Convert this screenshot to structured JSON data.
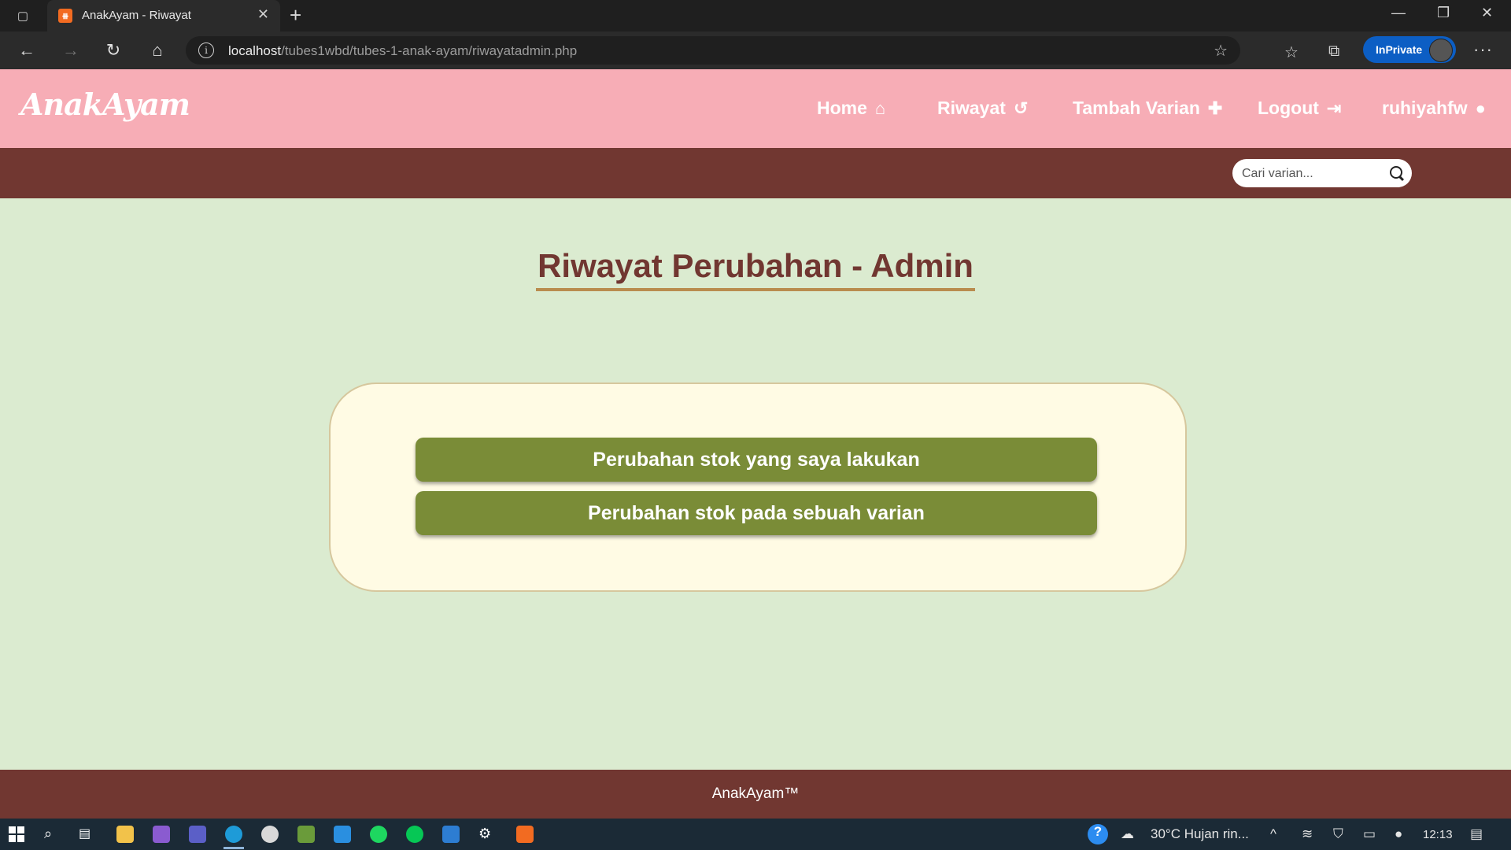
{
  "browser": {
    "tab_title": "AnakAyam - Riwayat",
    "tab_close": "✕",
    "favicon_text": "⧻",
    "url_host": "localhost",
    "url_path": "/tubes1wbd/tubes-1-anak-ayam/riwayatadmin.php",
    "inprivate_label": "InPrivate",
    "icons": [
      "back-icon",
      "forward-icon",
      "refresh-icon",
      "home-icon",
      "info-icon",
      "favorite-add-icon",
      "favorites-icon",
      "collections-icon",
      "more-icon"
    ]
  },
  "site": {
    "logo": "AnakAyam",
    "nav": {
      "home": "Home",
      "riwayat": "Riwayat",
      "tambah": "Tambah Varian",
      "logout": "Logout",
      "user": "ruhiyahfw"
    },
    "search_placeholder": "Cari varian...",
    "page_title": "Riwayat Perubahan - Admin",
    "buttons": {
      "mine": "Perubahan stok yang saya lakukan",
      "variant": "Perubahan stok pada sebuah varian"
    },
    "footer": "AnakAyam™"
  },
  "taskbar": {
    "weather": "30°C  Hujan rin...",
    "time": "12:13"
  },
  "colors": {
    "header": "#f7adb6",
    "subbar": "#713731",
    "background": "#dbebd0",
    "card": "#fffbe4",
    "button": "#7a8c37",
    "title": "#713731"
  }
}
